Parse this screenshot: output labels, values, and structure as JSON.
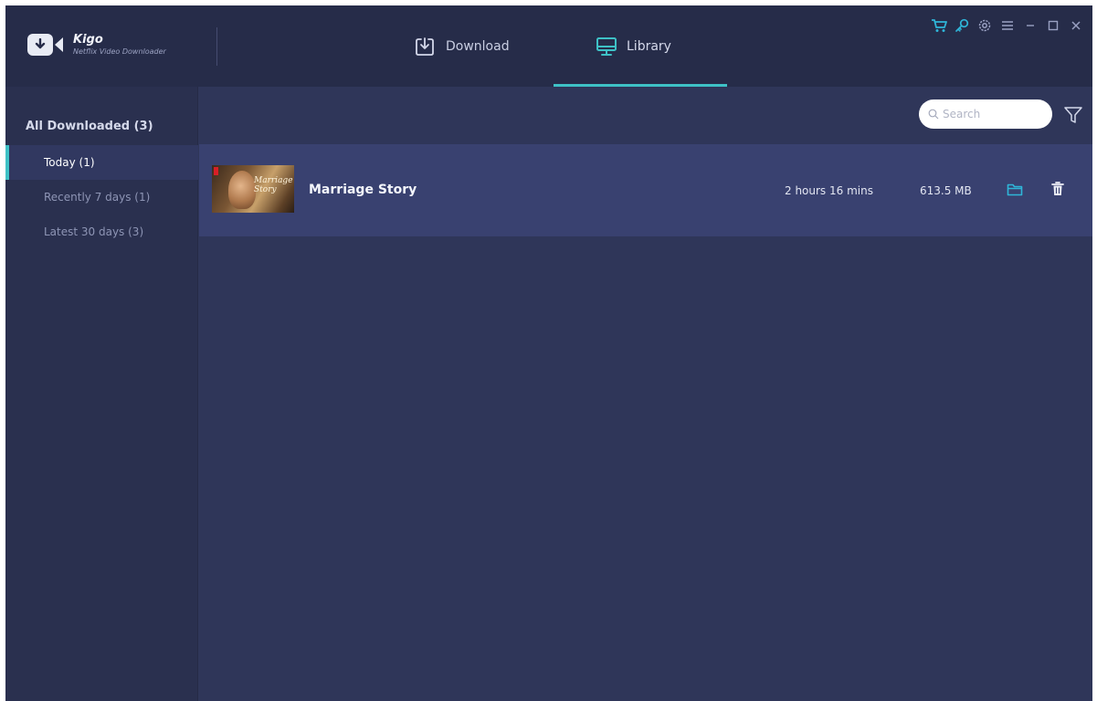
{
  "app": {
    "name": "Kigo",
    "subtitle": "Netflix Video Downloader",
    "logo_icon": "video-download-icon"
  },
  "tabs": [
    {
      "label": "Download",
      "icon": "download-box-icon",
      "active": false
    },
    {
      "label": "Library",
      "icon": "monitor-icon",
      "active": true
    }
  ],
  "window_controls": [
    {
      "name": "cart-icon"
    },
    {
      "name": "key-icon"
    },
    {
      "name": "gear-icon"
    },
    {
      "name": "menu-icon"
    },
    {
      "name": "minimize-icon"
    },
    {
      "name": "maximize-icon"
    },
    {
      "name": "close-icon"
    }
  ],
  "sidebar": {
    "all_label": "All Downloaded (3)",
    "items": [
      {
        "label": "Today (1)",
        "active": true
      },
      {
        "label": "Recently 7 days (1)",
        "active": false
      },
      {
        "label": "Latest 30 days (3)",
        "active": false
      }
    ]
  },
  "search": {
    "placeholder": "Search",
    "value": ""
  },
  "library": {
    "items": [
      {
        "title": "Marriage Story",
        "thumbnail_text": "Marriage Story",
        "duration": "2 hours 16 mins",
        "size": "613.5 MB"
      }
    ]
  },
  "colors": {
    "accent": "#3ec1c6",
    "header_bg": "#262c49",
    "sidebar_bg": "#2a304f",
    "main_bg": "#2f3659",
    "row_bg": "#394170",
    "icon_accent": "#2fb5d8"
  }
}
